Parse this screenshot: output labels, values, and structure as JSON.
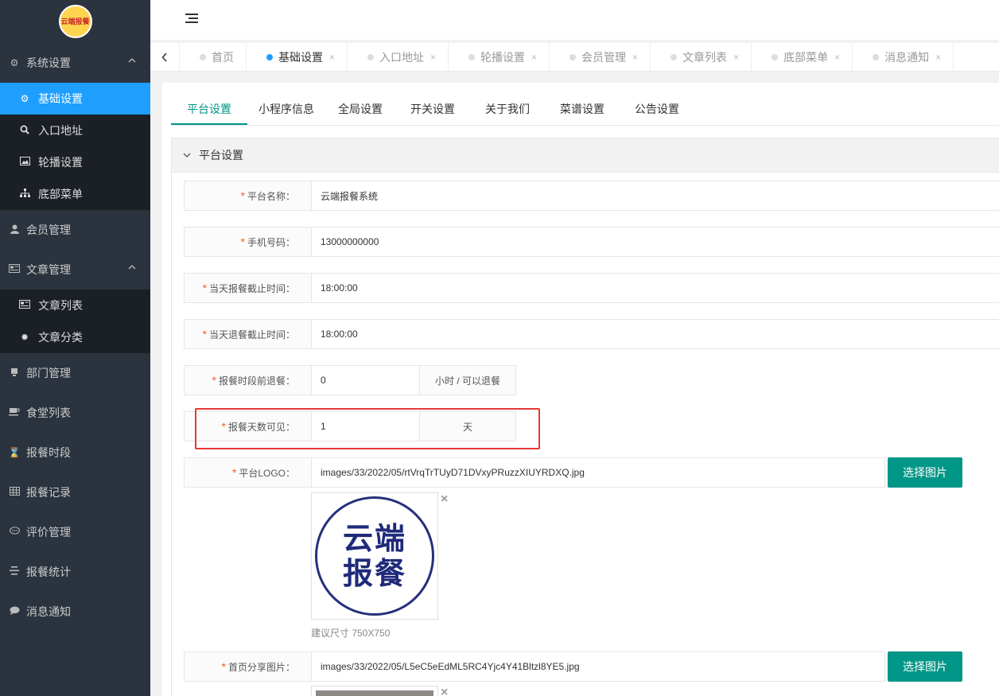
{
  "logo": {
    "text": "云端报餐"
  },
  "sidebar": {
    "groups": [
      {
        "label": "系统设置",
        "icon": "gears-icon"
      },
      {
        "label": "会员管理",
        "icon": "user-icon"
      },
      {
        "label": "文章管理",
        "icon": "newspaper-icon"
      },
      {
        "label": "部门管理",
        "icon": "department-icon"
      },
      {
        "label": "食堂列表",
        "icon": "coffee-icon"
      },
      {
        "label": "报餐时段",
        "icon": "hourglass-icon"
      },
      {
        "label": "报餐记录",
        "icon": "table-icon"
      },
      {
        "label": "评价管理",
        "icon": "comment-icon"
      },
      {
        "label": "报餐统计",
        "icon": "align-icon"
      },
      {
        "label": "消息通知",
        "icon": "message-icon"
      }
    ],
    "system_sub": [
      {
        "label": "基础设置",
        "icon": "gear-icon"
      },
      {
        "label": "入口地址",
        "icon": "search-icon"
      },
      {
        "label": "轮播设置",
        "icon": "image-icon"
      },
      {
        "label": "底部菜单",
        "icon": "sitemap-icon"
      }
    ],
    "article_sub": [
      {
        "label": "文章列表",
        "icon": "newspaper-icon"
      },
      {
        "label": "文章分类",
        "icon": "cog-icon"
      }
    ]
  },
  "page_tabs": [
    {
      "label": "首页"
    },
    {
      "label": "基础设置"
    },
    {
      "label": "入口地址"
    },
    {
      "label": "轮播设置"
    },
    {
      "label": "会员管理"
    },
    {
      "label": "文章列表"
    },
    {
      "label": "底部菜单"
    },
    {
      "label": "消息通知"
    }
  ],
  "close_glyph": "×",
  "sub_tabs": [
    "平台设置",
    "小程序信息",
    "全局设置",
    "开关设置",
    "关于我们",
    "菜谱设置",
    "公告设置"
  ],
  "panel_title": "平台设置",
  "form": {
    "platform_name": {
      "label": "平台名称：",
      "value": "云端报餐系统"
    },
    "phone": {
      "label": "手机号码：",
      "value": "13000000000"
    },
    "order_deadline": {
      "label": "当天报餐截止时间：",
      "value": "18:00:00"
    },
    "cancel_deadline": {
      "label": "当天退餐截止时间：",
      "value": "18:00:00"
    },
    "cancel_before": {
      "label": "报餐时段前退餐：",
      "value": "0",
      "addon": "小时 / 可以退餐"
    },
    "visible_days": {
      "label": "报餐天数可见：",
      "value": "1",
      "addon": "天"
    },
    "platform_logo": {
      "label": "平台LOGO：",
      "value": "images/33/2022/05/rtVrqTrTUyD71DVxyPRuzzXIUYRDXQ.jpg",
      "button": "选择图片",
      "hint": "建议尺寸 750X750"
    },
    "share_image": {
      "label": "首页分享图片：",
      "value": "images/33/2022/05/L5eC5eEdML5RC4Yjc4Y41Bltzl8YE5.jpg",
      "button": "选择图片"
    }
  },
  "logo_image": {
    "line1": "云端",
    "line2": "报餐"
  },
  "required_mark": "*"
}
